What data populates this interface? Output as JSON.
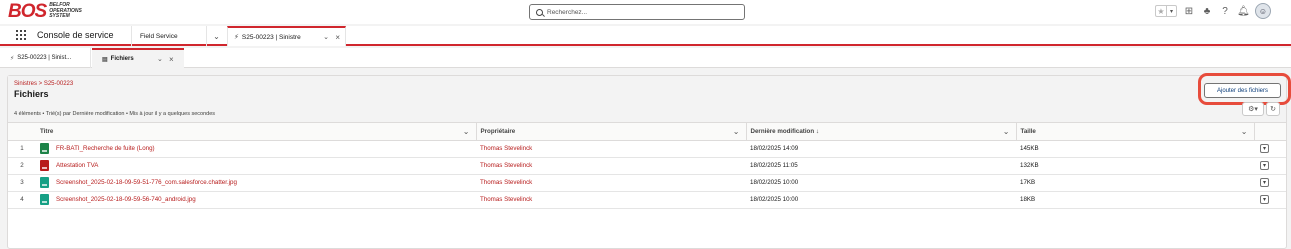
{
  "header": {
    "logo_main": "BOS",
    "logo_line1": "BELFOR",
    "logo_line2": "OPERATIONS",
    "logo_line3": "SYSTEM",
    "search_placeholder": "Recherchez...",
    "icons": [
      "star-icon",
      "chevron-down-icon",
      "add-icon",
      "trailhead-icon",
      "help-icon",
      "bell-icon",
      "avatar"
    ]
  },
  "nav": {
    "app_name": "Console de service",
    "dropdown_value": "Field Service",
    "tab_label": "S25-00223 | Sinistre"
  },
  "subtabs": {
    "tab1_label": "S25-00223 | Sinist...",
    "tab2_label": "Fichiers"
  },
  "page": {
    "breadcrumb": "Sinistres > S25-00223",
    "title": "Fichiers",
    "meta": "4 éléments • Trié(s) par Dernière modification • Mis à jour il y a quelques secondes",
    "add_button": "Ajouter des fichiers"
  },
  "table": {
    "columns": [
      "Titre",
      "Propriétaire",
      "Dernière modification ↓",
      "Taille"
    ],
    "rows": [
      {
        "num": "1",
        "title": "FR-BATI_Recherche de fuite (Long)",
        "owner": "Thomas Stevelinck",
        "modified": "18/02/2025 14:09",
        "size": "145KB"
      },
      {
        "num": "2",
        "title": "Attestation TVA",
        "owner": "Thomas Stevelinck",
        "modified": "18/02/2025 11:05",
        "size": "132KB"
      },
      {
        "num": "3",
        "title": "Screenshot_2025-02-18-09-59-51-776_com.salesforce.chatter.jpg",
        "owner": "Thomas Stevelinck",
        "modified": "18/02/2025 10:00",
        "size": "17KB"
      },
      {
        "num": "4",
        "title": "Screenshot_2025-02-18-09-59-56-740_android.jpg",
        "owner": "Thomas Stevelinck",
        "modified": "18/02/2025 10:00",
        "size": "18KB"
      }
    ]
  },
  "colors": {
    "brand_red": "#d0262d",
    "link_red": "#b71c1c",
    "highlight": "#e74c3c"
  }
}
